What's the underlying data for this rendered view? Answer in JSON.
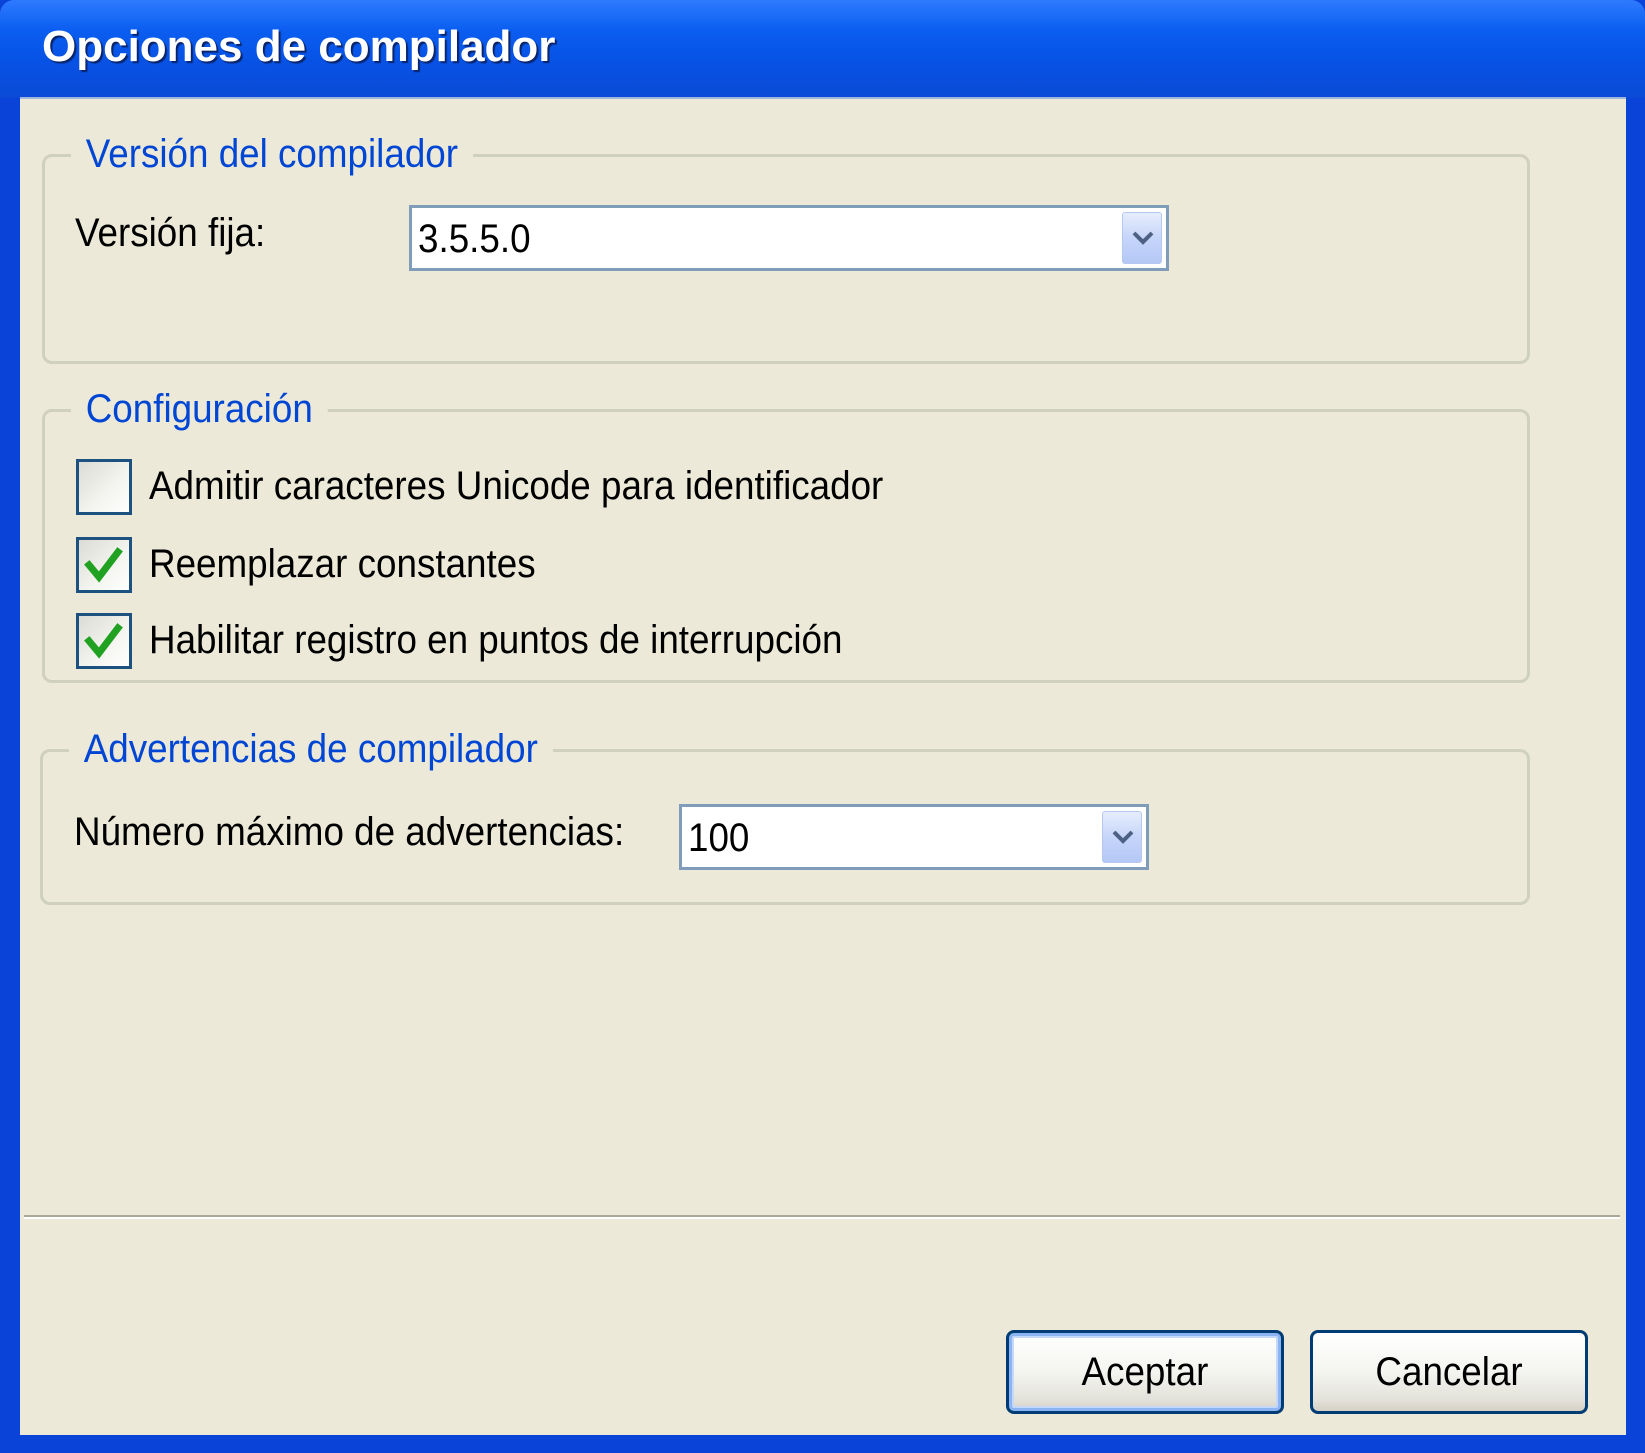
{
  "dialog": {
    "title": "Opciones de compilador"
  },
  "compiler_version": {
    "group_title": "Versión del compilador",
    "fixed_version_label": "Versión fija:",
    "fixed_version_value": "3.5.5.0"
  },
  "configuration": {
    "group_title": "Configuración",
    "options": [
      {
        "label": "Admitir caracteres Unicode para identificador",
        "checked": false
      },
      {
        "label": "Reemplazar constantes",
        "checked": true
      },
      {
        "label": "Habilitar registro en puntos de interrupción",
        "checked": true
      }
    ]
  },
  "warnings": {
    "group_title": "Advertencias de compilador",
    "max_warnings_label": "Número máximo de advertencias:",
    "max_warnings_value": "100"
  },
  "buttons": {
    "ok_label": "Aceptar",
    "cancel_label": "Cancelar"
  },
  "colors": {
    "titlebar": "#0a4ad6",
    "dialog_background": "#ece9d8",
    "group_title": "#0046d5",
    "check_mark": "#21a121"
  },
  "icons": {
    "combo_arrow": "chevron-down-icon",
    "check": "checkmark-icon"
  }
}
